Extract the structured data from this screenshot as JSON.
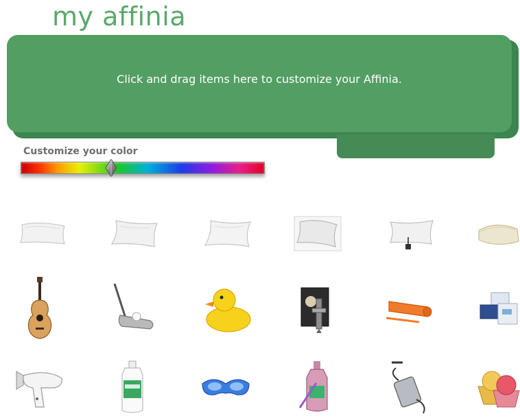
{
  "app": {
    "logo_text": "my affinia",
    "brand_color": "#5aa86a"
  },
  "drop_zone": {
    "instruction": "Click and drag items here to customize your Affinia.",
    "color": "#539e62"
  },
  "color_picker": {
    "label": "Customize your color",
    "selected_fraction": 0.37
  },
  "items": [
    {
      "name": "pillow-flat-item",
      "icon": "pillow-icon"
    },
    {
      "name": "pillow-standard-item",
      "icon": "pillow-icon"
    },
    {
      "name": "pillow-plump-item",
      "icon": "pillow-icon"
    },
    {
      "name": "pillow-down-item",
      "icon": "pillow-icon"
    },
    {
      "name": "pillow-electric-item",
      "icon": "heated-pillow-icon"
    },
    {
      "name": "pillow-memory-foam-item",
      "icon": "foam-pillow-icon"
    },
    {
      "name": "guitar-item",
      "icon": "guitar-icon"
    },
    {
      "name": "golf-putter-item",
      "icon": "golf-putter-icon"
    },
    {
      "name": "rubber-duck-item",
      "icon": "rubber-duck-icon"
    },
    {
      "name": "wine-corkscrew-item",
      "icon": "corkscrew-icon"
    },
    {
      "name": "yoga-mat-item",
      "icon": "yoga-mat-icon"
    },
    {
      "name": "toiletries-kit-item",
      "icon": "toiletries-icon"
    },
    {
      "name": "hair-dryer-item",
      "icon": "hair-dryer-icon"
    },
    {
      "name": "contact-solution-item",
      "icon": "contact-solution-icon"
    },
    {
      "name": "eye-mask-item",
      "icon": "eye-mask-icon"
    },
    {
      "name": "bath-bottle-item",
      "icon": "bath-bottle-icon"
    },
    {
      "name": "power-adapter-item",
      "icon": "power-adapter-icon"
    },
    {
      "name": "cupcakes-item",
      "icon": "cupcakes-icon"
    }
  ]
}
